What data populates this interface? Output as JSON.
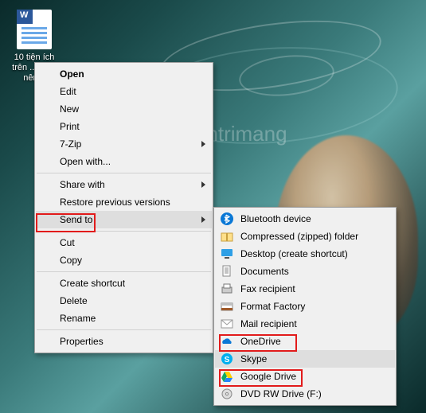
{
  "desktop_file": {
    "label": "10 tiện ích trên ... bạ... nên..."
  },
  "watermark": {
    "text": "uantrimang"
  },
  "menu1": {
    "open": "Open",
    "edit": "Edit",
    "new": "New",
    "print": "Print",
    "sevenzip": "7-Zip",
    "openwith": "Open with...",
    "sharewith": "Share with",
    "restore": "Restore previous versions",
    "sendto": "Send to",
    "cut": "Cut",
    "copy": "Copy",
    "shortcut": "Create shortcut",
    "delete": "Delete",
    "rename": "Rename",
    "properties": "Properties"
  },
  "menu2": {
    "bluetooth": "Bluetooth device",
    "zip": "Compressed (zipped) folder",
    "desktop": "Desktop (create shortcut)",
    "documents": "Documents",
    "fax": "Fax recipient",
    "format": "Format Factory",
    "mail": "Mail recipient",
    "onedrive": "OneDrive",
    "skype": "Skype",
    "gdrive": "Google Drive",
    "dvd": "DVD RW Drive (F:)"
  }
}
